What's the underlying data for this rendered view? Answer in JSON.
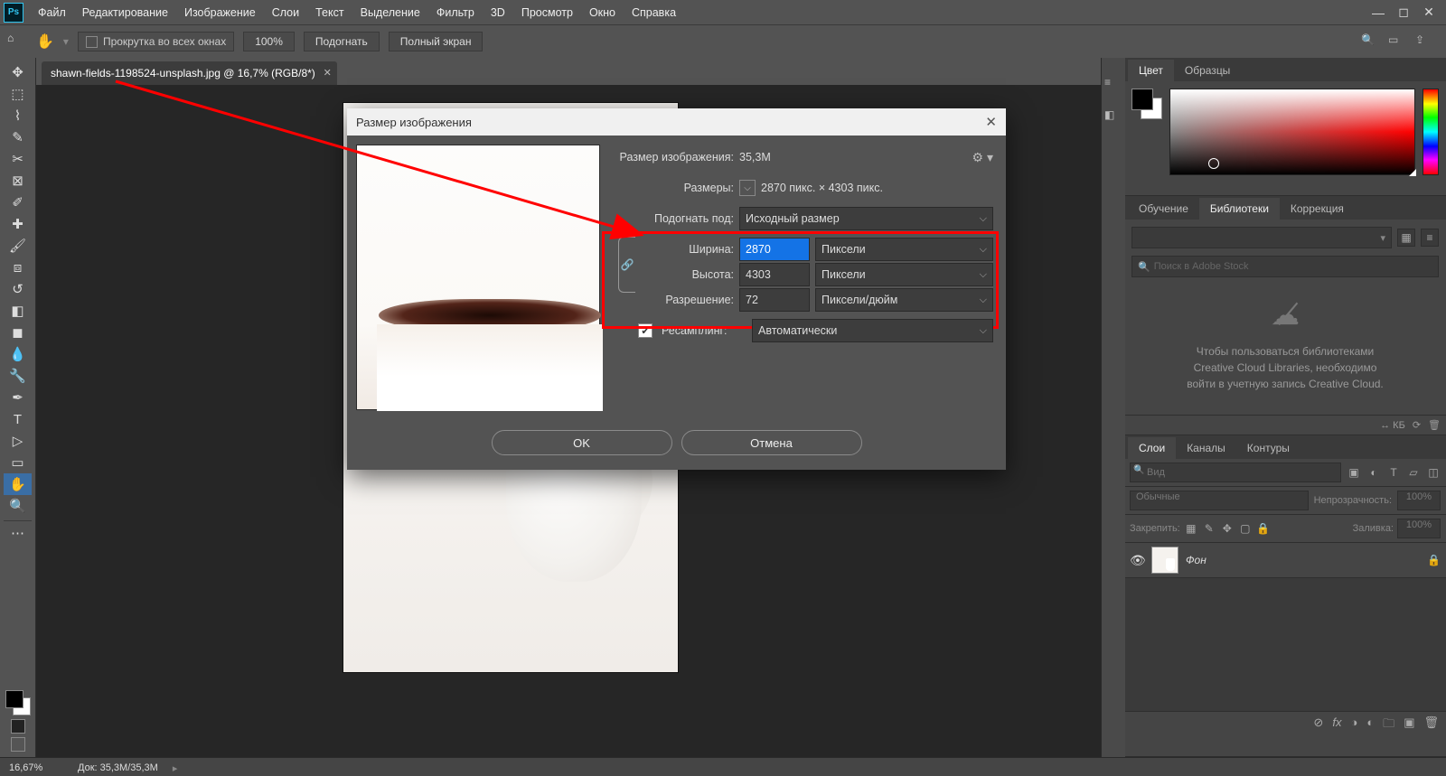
{
  "menu": [
    "Файл",
    "Редактирование",
    "Изображение",
    "Слои",
    "Текст",
    "Выделение",
    "Фильтр",
    "3D",
    "Просмотр",
    "Окно",
    "Справка"
  ],
  "options": {
    "scroll_all": "Прокрутка во всех окнах",
    "zoom": "100%",
    "fit": "Подогнать",
    "fullscreen": "Полный экран"
  },
  "doc_tab": "shawn-fields-1198524-unsplash.jpg @ 16,7% (RGB/8*)",
  "dialog": {
    "title": "Размер изображения",
    "img_size_label": "Размер изображения:",
    "img_size_val": "35,3M",
    "dims_label": "Размеры:",
    "dims_val": "2870 пикс. × 4303 пикс.",
    "fit_label": "Подогнать под:",
    "fit_val": "Исходный размер",
    "width_label": "Ширина:",
    "width_val": "2870",
    "height_label": "Высота:",
    "height_val": "4303",
    "unit_px": "Пиксели",
    "res_label": "Разрешение:",
    "res_val": "72",
    "res_unit": "Пиксели/дюйм",
    "resample_label": "Ресамплинг:",
    "resample_val": "Автоматически",
    "ok": "OK",
    "cancel": "Отмена"
  },
  "panels": {
    "color_tabs": [
      "Цвет",
      "Образцы"
    ],
    "lib_tabs": [
      "Обучение",
      "Библиотеки",
      "Коррекция"
    ],
    "lib_search_ph": "Поиск в Adobe Stock",
    "lib_msg1": "Чтобы пользоваться библиотеками",
    "lib_msg2": "Creative Cloud Libraries, необходимо",
    "lib_msg3": "войти в учетную запись Creative Cloud.",
    "lib_kb": "↔ КБ",
    "layer_tabs": [
      "Слои",
      "Каналы",
      "Контуры"
    ],
    "layer_search_ph": "Вид",
    "blend": "Обычные",
    "opacity_label": "Непрозрачность:",
    "opacity_val": "100%",
    "lock_label": "Закрепить:",
    "fill_label": "Заливка:",
    "fill_val": "100%",
    "bg_layer": "Фон"
  },
  "status": {
    "zoom": "16,67%",
    "doc": "Док: 35,3M/35,3M"
  }
}
